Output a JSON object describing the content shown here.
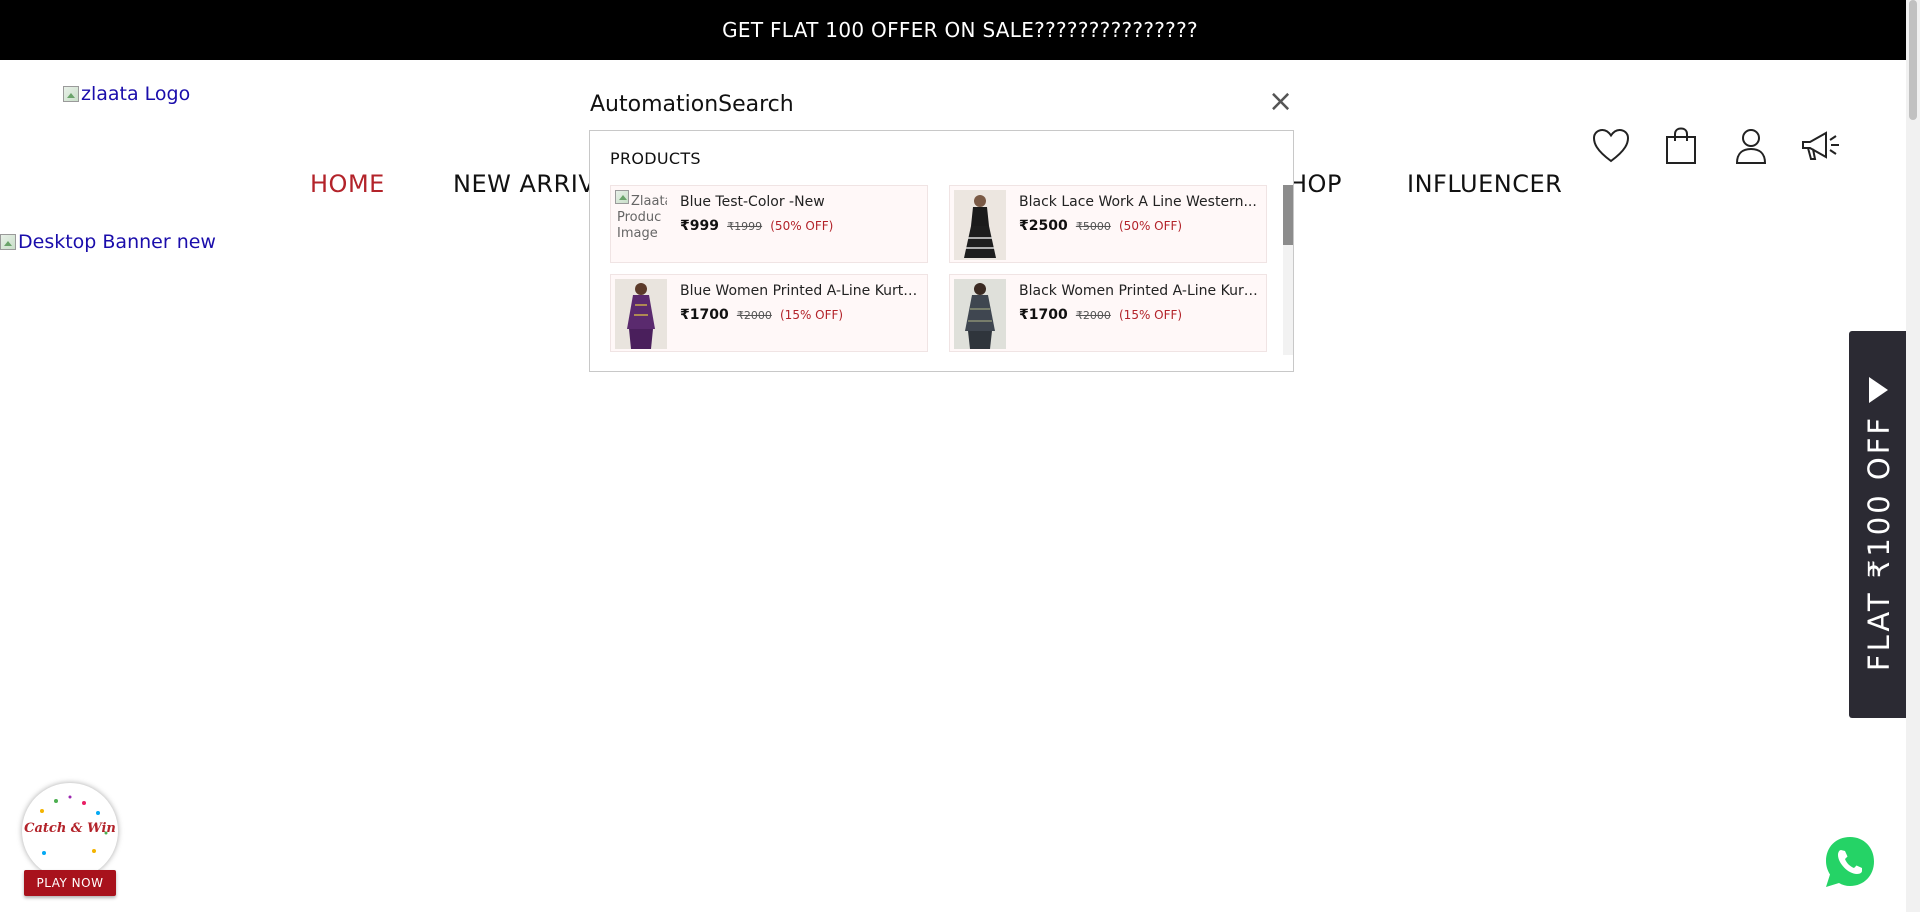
{
  "announcement": "GET FLAT 100 OFFER ON SALE???????????????",
  "logo_alt": "zlaata Logo",
  "banner_alt": "Desktop Banner new",
  "nav": {
    "home": "HOME",
    "new_arrivals": "NEW ARRIV",
    "shop": "HOP",
    "influencer": "INFLUENCER"
  },
  "header_icons": [
    "heart-icon",
    "shopping-bag-icon",
    "user-icon",
    "megaphone-icon"
  ],
  "search": {
    "query": "AutomationSearch",
    "close": "×",
    "section_heading": "PRODUCTS",
    "products": [
      {
        "name": "Blue Test-Color -New",
        "price": "₹999",
        "mrp": "₹1999",
        "discount": "(50% OFF)",
        "image_alt": [
          "Zlaata",
          "Produc",
          "Image"
        ]
      },
      {
        "name": "Black Lace Work A Line Western...",
        "price": "₹2500",
        "mrp": "₹5000",
        "discount": "(50% OFF)"
      },
      {
        "name": "Blue Women Printed A-Line Kurta...",
        "price": "₹1700",
        "mrp": "₹2000",
        "discount": "(15% OFF)"
      },
      {
        "name": "Black Women Printed A-Line Kurt...",
        "price": "₹1700",
        "mrp": "₹2000",
        "discount": "(15% OFF)"
      }
    ]
  },
  "side_offer": "FLAT ₹100 OFF",
  "game": {
    "title": "Catch & Win",
    "button": "PLAY NOW"
  },
  "colors": {
    "accent": "#b3232a",
    "topbar": "#000000",
    "side_panel": "#2b2a33",
    "whatsapp": "#25d366"
  }
}
